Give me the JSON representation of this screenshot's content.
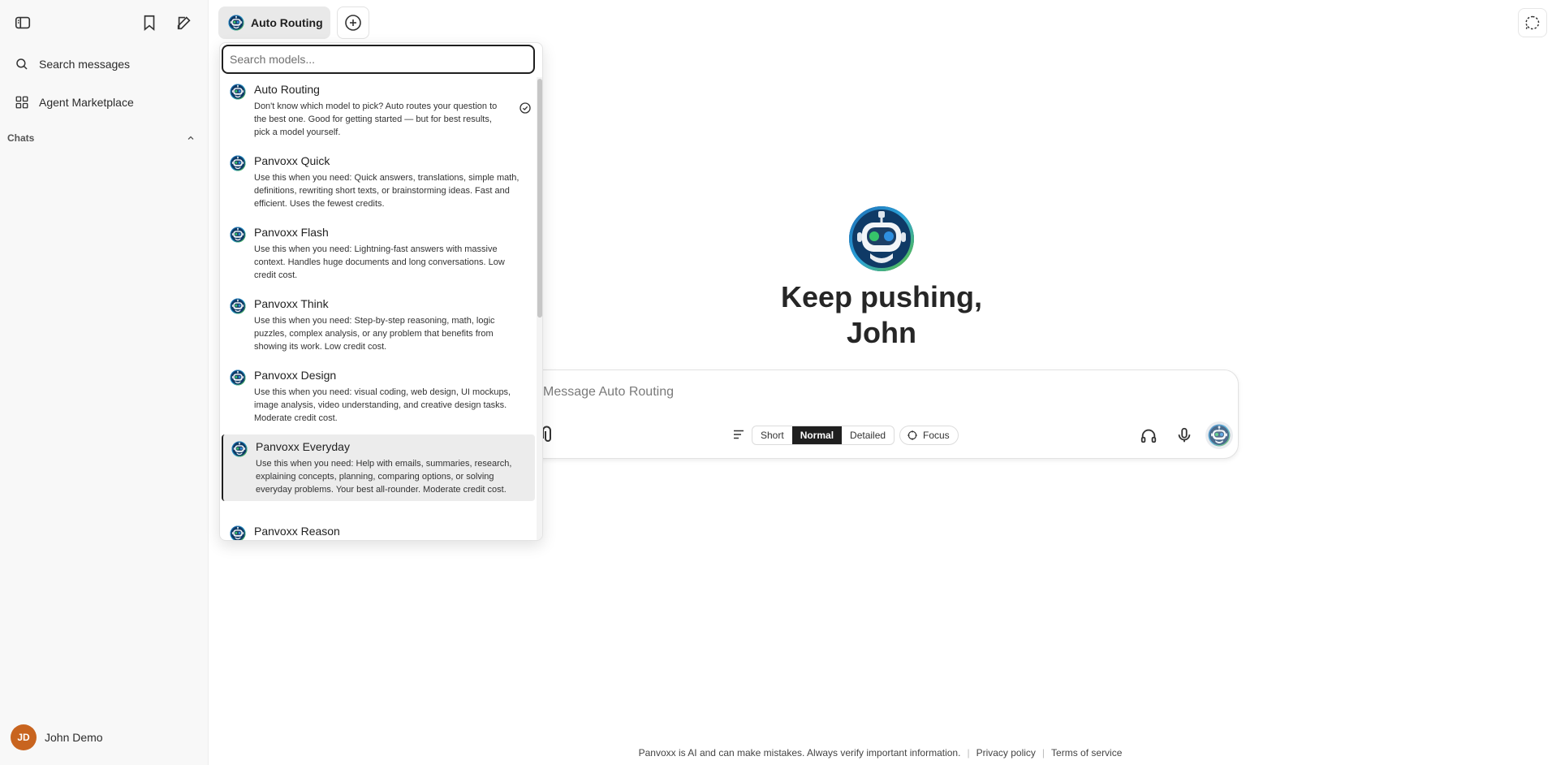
{
  "sidebar": {
    "search_label": "Search messages",
    "marketplace_label": "Agent Marketplace",
    "chats_label": "Chats",
    "user": {
      "initials": "JD",
      "name": "John Demo"
    }
  },
  "header": {
    "model_chip_label": "Auto Routing"
  },
  "hero": {
    "greeting_line1": "Keep pushing,",
    "greeting_line2": "John"
  },
  "composer": {
    "placeholder": "Message Auto Routing",
    "length_options": [
      "Short",
      "Normal",
      "Detailed"
    ],
    "selected_length": "Normal",
    "focus_label": "Focus"
  },
  "model_menu": {
    "search_placeholder": "Search models...",
    "options": [
      {
        "name": "Auto Routing",
        "desc": "Don't know which model to pick? Auto routes your question to the best one. Good for getting started — but for best results, pick a model yourself.",
        "selected": true
      },
      {
        "name": "Panvoxx Quick",
        "desc": "Use this when you need: Quick answers, translations, simple math, definitions, rewriting short texts, or brainstorming ideas. Fast and efficient. Uses the fewest credits."
      },
      {
        "name": "Panvoxx Flash",
        "desc": "Use this when you need: Lightning-fast answers with massive context. Handles huge documents and long conversations. Low credit cost."
      },
      {
        "name": "Panvoxx Think",
        "desc": "Use this when you need: Step-by-step reasoning, math, logic puzzles, complex analysis, or any problem that benefits from showing its work. Low credit cost."
      },
      {
        "name": "Panvoxx Design",
        "desc": "Use this when you need: visual coding, web design, UI mockups, image analysis, video understanding, and creative design tasks. Moderate credit cost."
      },
      {
        "name": "Panvoxx Everyday",
        "desc": "Use this when you need: Help with emails, summaries, research, explaining concepts, planning, comparing options, or solving everyday problems. Your best all-rounder. Moderate credit cost.",
        "highlighted": true
      },
      {
        "name": "Panvoxx Reason",
        "desc": ""
      }
    ]
  },
  "footer": {
    "disclaimer": "Panvoxx is AI and can make mistakes. Always verify important information.",
    "privacy": "Privacy policy",
    "terms": "Terms of service"
  },
  "colors": {
    "accent_dark": "#1f1f1f",
    "sidebar_bg": "#f8f8f8",
    "avatar_bg": "#c8641f",
    "highlight_bg": "#ececec"
  }
}
